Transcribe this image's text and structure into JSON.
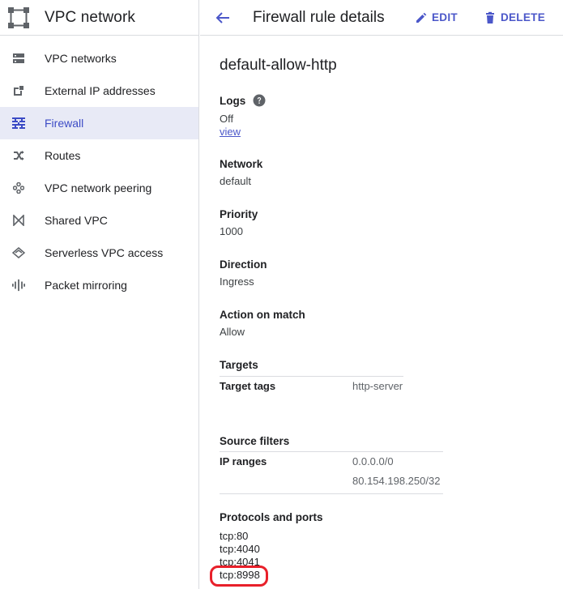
{
  "sidebar": {
    "title": "VPC network",
    "items": [
      {
        "label": "VPC networks",
        "icon": "vpc-networks-icon",
        "active": false
      },
      {
        "label": "External IP addresses",
        "icon": "external-ip-icon",
        "active": false
      },
      {
        "label": "Firewall",
        "icon": "firewall-icon",
        "active": true
      },
      {
        "label": "Routes",
        "icon": "routes-icon",
        "active": false
      },
      {
        "label": "VPC network peering",
        "icon": "peering-icon",
        "active": false
      },
      {
        "label": "Shared VPC",
        "icon": "shared-vpc-icon",
        "active": false
      },
      {
        "label": "Serverless VPC access",
        "icon": "serverless-icon",
        "active": false
      },
      {
        "label": "Packet mirroring",
        "icon": "packet-mirroring-icon",
        "active": false
      }
    ]
  },
  "header": {
    "title": "Firewall rule details",
    "edit_label": "EDIT",
    "delete_label": "DELETE"
  },
  "rule": {
    "name": "default-allow-http",
    "logs_label": "Logs",
    "logs_value": "Off",
    "logs_link": "view",
    "network_label": "Network",
    "network_value": "default",
    "priority_label": "Priority",
    "priority_value": "1000",
    "direction_label": "Direction",
    "direction_value": "Ingress",
    "action_label": "Action on match",
    "action_value": "Allow",
    "targets_label": "Targets",
    "target_tags_key": "Target tags",
    "target_tags_value": "http-server",
    "source_filters_label": "Source filters",
    "ip_ranges_key": "IP ranges",
    "ip_ranges": [
      "0.0.0.0/0",
      "80.154.198.250/32"
    ],
    "protocols_label": "Protocols and ports",
    "ports": [
      "tcp:80",
      "tcp:4040",
      "tcp:4041",
      "tcp:8998"
    ]
  },
  "colors": {
    "accent": "#4b57c9",
    "active_bg": "#e8eaf6",
    "highlight": "#e8202a"
  }
}
